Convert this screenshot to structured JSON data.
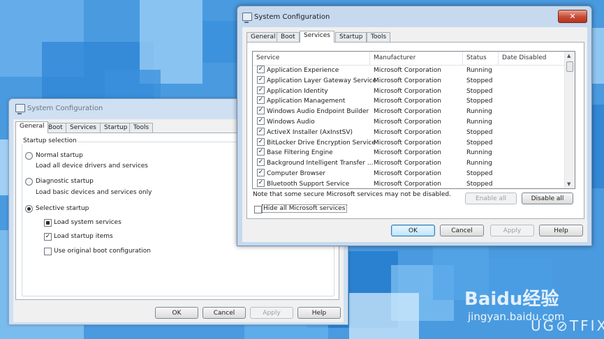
{
  "background": {
    "tiles": [
      {
        "c": "#6db3ee"
      },
      {
        "c": "#2f86d6"
      },
      {
        "c": "#9fd0f7"
      },
      {
        "c": "#3a8fdc"
      },
      {
        "c": "#bfe2fb"
      },
      {
        "c": "#1f78cb"
      },
      {
        "c": "#7fc0f2"
      },
      {
        "c": "#56a6e8"
      },
      {
        "c": "#a8d5f8"
      },
      {
        "c": "#2c80d2"
      },
      {
        "c": "#8cc7f4"
      },
      {
        "c": "#4b9de3"
      },
      {
        "c": "#d2ebfc"
      },
      {
        "c": "#3b90dc"
      },
      {
        "c": "#66b1ed"
      }
    ]
  },
  "window1": {
    "title": "System Configuration",
    "tabs": [
      "General",
      "Boot",
      "Services",
      "Startup",
      "Tools"
    ],
    "group_label": "Startup selection",
    "options": [
      {
        "label": "Normal startup",
        "desc": "Load all device drivers and services",
        "checked": false
      },
      {
        "label": "Diagnostic startup",
        "desc": "Load basic devices and services only",
        "checked": false
      },
      {
        "label": "Selective startup",
        "desc": "",
        "checked": true
      }
    ],
    "sub_options": [
      {
        "label": "Load system services",
        "state": "mixed"
      },
      {
        "label": "Load startup items",
        "state": "checked"
      },
      {
        "label": "Use original boot configuration",
        "state": "unchecked"
      }
    ],
    "buttons": {
      "ok": "OK",
      "cancel": "Cancel",
      "apply": "Apply",
      "help": "Help"
    }
  },
  "window2": {
    "title": "System Configuration",
    "close_glyph": "✕",
    "tabs": [
      "General",
      "Boot",
      "Services",
      "Startup",
      "Tools"
    ],
    "columns": [
      "Service",
      "Manufacturer",
      "Status",
      "Date Disabled"
    ],
    "services": [
      {
        "name": "Application Experience",
        "manufacturer": "Microsoft Corporation",
        "status": "Running"
      },
      {
        "name": "Application Layer Gateway Service",
        "manufacturer": "Microsoft Corporation",
        "status": "Stopped"
      },
      {
        "name": "Application Identity",
        "manufacturer": "Microsoft Corporation",
        "status": "Stopped"
      },
      {
        "name": "Application Management",
        "manufacturer": "Microsoft Corporation",
        "status": "Stopped"
      },
      {
        "name": "Windows Audio Endpoint Builder",
        "manufacturer": "Microsoft Corporation",
        "status": "Running"
      },
      {
        "name": "Windows Audio",
        "manufacturer": "Microsoft Corporation",
        "status": "Running"
      },
      {
        "name": "ActiveX Installer (AxInstSV)",
        "manufacturer": "Microsoft Corporation",
        "status": "Stopped"
      },
      {
        "name": "BitLocker Drive Encryption Service",
        "manufacturer": "Microsoft Corporation",
        "status": "Stopped"
      },
      {
        "name": "Base Filtering Engine",
        "manufacturer": "Microsoft Corporation",
        "status": "Running"
      },
      {
        "name": "Background Intelligent Transfer ...",
        "manufacturer": "Microsoft Corporation",
        "status": "Running"
      },
      {
        "name": "Computer Browser",
        "manufacturer": "Microsoft Corporation",
        "status": "Stopped"
      },
      {
        "name": "Bluetooth Support Service",
        "manufacturer": "Microsoft Corporation",
        "status": "Stopped"
      }
    ],
    "note": "Note that some secure Microsoft services may not be disabled.",
    "enable_all": "Enable all",
    "disable_all": "Disable all",
    "hide_ms": "Hide all Microsoft services",
    "buttons": {
      "ok": "OK",
      "cancel": "Cancel",
      "apply": "Apply",
      "help": "Help"
    }
  },
  "watermark": {
    "baidu": "Baidu经验",
    "site": "jingyan.baidu.com",
    "ugetfix": "UG⊘TFIX"
  }
}
